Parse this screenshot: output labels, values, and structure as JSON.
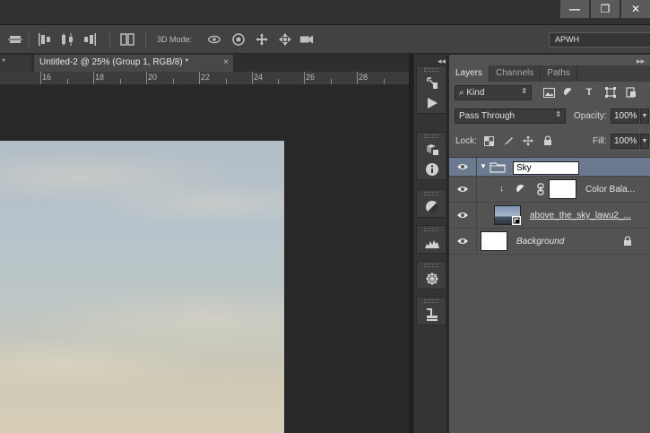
{
  "window_buttons": [
    "—",
    "❐",
    "✕"
  ],
  "options_bar": {
    "mode_label": "3D Mode:",
    "workspace": "APWH"
  },
  "doc_tabs": [
    {
      "label": ") *"
    },
    {
      "label": "Untitled-2 @ 25% (Group 1, RGB/8) *",
      "close": "×"
    }
  ],
  "ruler": {
    "labels": [
      "16",
      "18",
      "20",
      "22",
      "24",
      "26",
      "28"
    ]
  },
  "dock": {
    "collapse": "◂◂"
  },
  "layers_panel": {
    "collapse": "▸▸",
    "tabs": [
      "Layers",
      "Channels",
      "Paths"
    ],
    "filter_kind": "Kind",
    "blend_mode": "Pass Through",
    "opacity_label": "Opacity:",
    "opacity_value": "100%",
    "lock_label": "Lock:",
    "fill_label": "Fill:",
    "fill_value": "100%",
    "layers": [
      {
        "name": "Sky",
        "type": "group",
        "editing": true
      },
      {
        "name": "Color Bala...",
        "type": "adjustment"
      },
      {
        "name": "above_the_sky_lawu2_...",
        "type": "smart-object"
      },
      {
        "name": "Background",
        "type": "background",
        "locked": true
      }
    ]
  },
  "colors": {
    "selected_layer": "#6b7a90",
    "panel_bg": "#535353",
    "app_bg": "#282828"
  }
}
